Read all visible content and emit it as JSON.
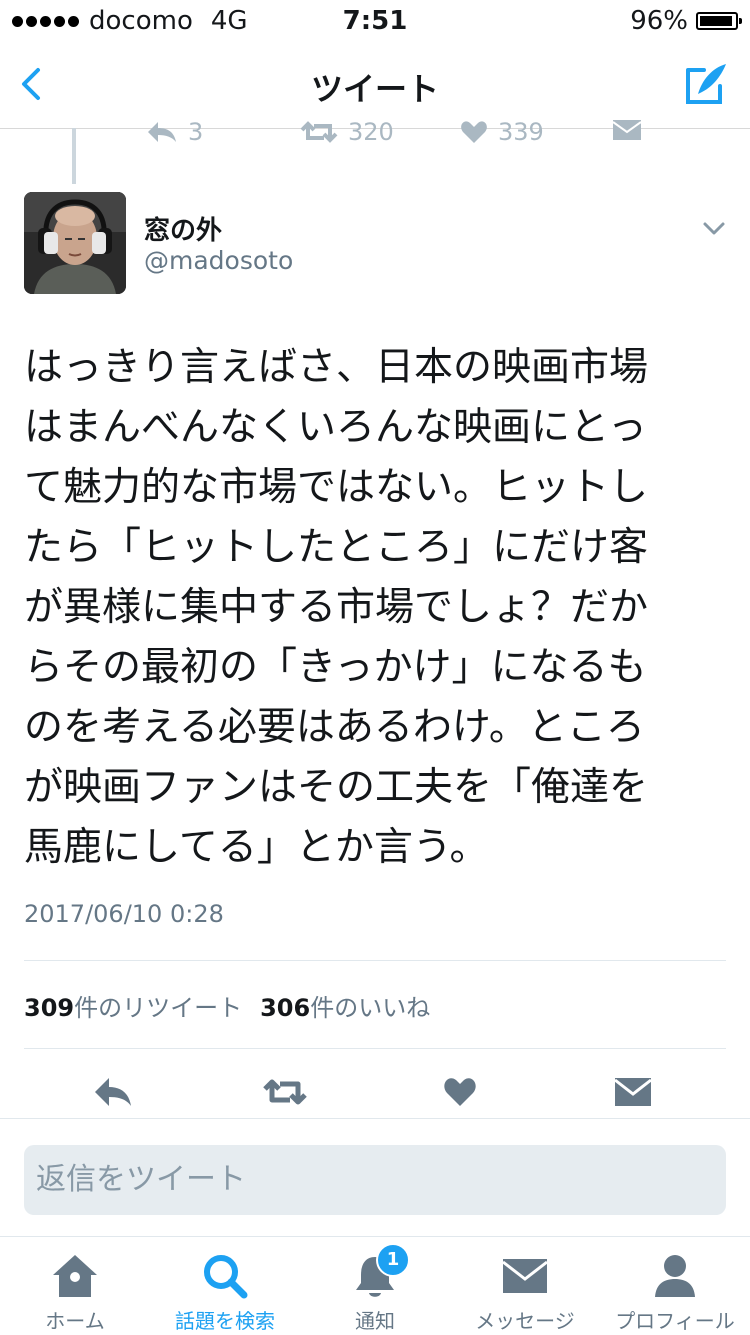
{
  "status_bar": {
    "carrier": "docomo",
    "network": "4G",
    "time": "7:51",
    "battery": "96%"
  },
  "nav": {
    "title": "ツイート"
  },
  "previous_tweet": {
    "replies": "3",
    "retweets": "320",
    "likes": "339"
  },
  "tweet": {
    "name": "窓の外",
    "handle": "@madosoto",
    "lines": [
      "はっきり言えばさ、日本の映画市場",
      "はまんべんなくいろんな映画にとっ",
      "て魅力的な市場ではない。ヒットし",
      "たら「ヒットしたところ」にだけ客",
      "が異様に集中する市場でしょ？だか",
      "らその最初の「きっかけ」になるも",
      "のを考える必要はあるわけ。ところ",
      "が映画ファンはその工夫を「俺達を",
      "馬鹿にしてる」とか言う。"
    ],
    "timestamp": "2017/06/10 0:28",
    "retweet_count": "309",
    "retweet_label": "件のリツイート",
    "like_count": "306",
    "like_label": "件のいいね"
  },
  "reply": {
    "placeholder": "返信をツイート"
  },
  "tabs": [
    {
      "label": "ホーム",
      "icon": "home-icon"
    },
    {
      "label": "話題を検索",
      "icon": "search-icon",
      "active": true
    },
    {
      "label": "通知",
      "icon": "bell-icon",
      "badge": "1"
    },
    {
      "label": "メッセージ",
      "icon": "mail-icon"
    },
    {
      "label": "プロフィール",
      "icon": "person-icon"
    }
  ],
  "colors": {
    "accent": "#1da1f2",
    "icon_gray": "#657786",
    "text": "#14171a"
  }
}
